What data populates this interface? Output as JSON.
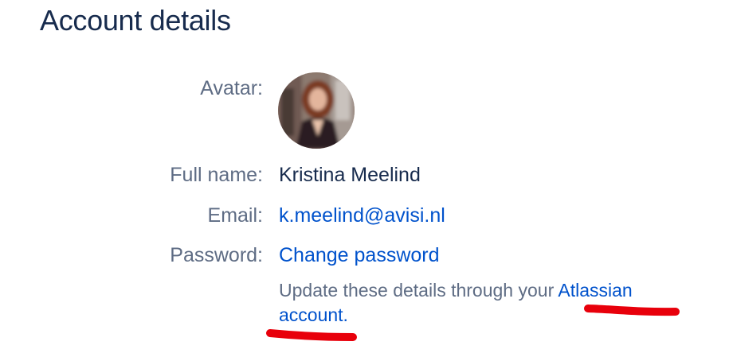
{
  "page": {
    "title": "Account details"
  },
  "fields": {
    "avatar_label": "Avatar:",
    "full_name_label": "Full name:",
    "full_name_value": "Kristina Meelind",
    "email_label": "Email:",
    "email_value": "k.meelind@avisi.nl",
    "password_label": "Password:",
    "password_link": "Change password"
  },
  "note": {
    "text": "Update these details through your ",
    "link": "Atlassian account."
  },
  "colors": {
    "heading": "#172b4d",
    "label": "#5e6c84",
    "link": "#0052cc",
    "annotation": "#e8000b"
  }
}
